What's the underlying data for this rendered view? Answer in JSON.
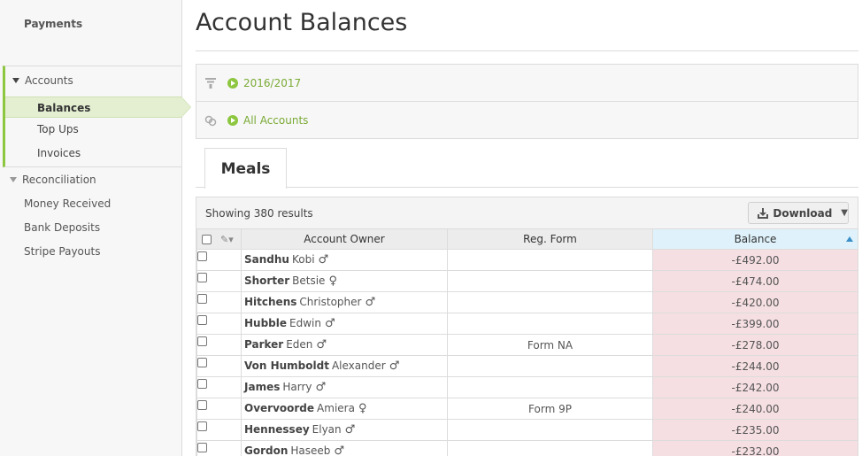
{
  "sidebar": {
    "payments": "Payments",
    "accounts": "Accounts",
    "balances": "Balances",
    "top_ups": "Top Ups",
    "invoices": "Invoices",
    "reconciliation": "Reconciliation",
    "money_received": "Money Received",
    "bank_deposits": "Bank Deposits",
    "stripe_payouts": "Stripe Payouts"
  },
  "page": {
    "title": "Account Balances"
  },
  "filters": {
    "year": "2016/2017",
    "accounts": "All Accounts"
  },
  "tabs": [
    {
      "label": "Meals"
    }
  ],
  "results": {
    "showing": "Showing 380 results",
    "download": "Download"
  },
  "table": {
    "headers": {
      "owner": "Account Owner",
      "reg_form": "Reg. Form",
      "balance": "Balance"
    },
    "rows": [
      {
        "surname": "Sandhu",
        "first": "Kobi",
        "gender": "♂",
        "reg_form": "",
        "balance": "-£492.00"
      },
      {
        "surname": "Shorter",
        "first": "Betsie",
        "gender": "♀",
        "reg_form": "",
        "balance": "-£474.00"
      },
      {
        "surname": "Hitchens",
        "first": "Christopher",
        "gender": "♂",
        "reg_form": "",
        "balance": "-£420.00"
      },
      {
        "surname": "Hubble",
        "first": "Edwin",
        "gender": "♂",
        "reg_form": "",
        "balance": "-£399.00"
      },
      {
        "surname": "Parker",
        "first": "Eden",
        "gender": "♂",
        "reg_form": "Form NA",
        "balance": "-£278.00"
      },
      {
        "surname": "Von Humboldt",
        "first": "Alexander",
        "gender": "♂",
        "reg_form": "",
        "balance": "-£244.00"
      },
      {
        "surname": "James",
        "first": "Harry",
        "gender": "♂",
        "reg_form": "",
        "balance": "-£242.00"
      },
      {
        "surname": "Overvoorde",
        "first": "Amiera",
        "gender": "♀",
        "reg_form": "Form 9P",
        "balance": "-£240.00"
      },
      {
        "surname": "Hennessey",
        "first": "Elyan",
        "gender": "♂",
        "reg_form": "",
        "balance": "-£235.00"
      },
      {
        "surname": "Gordon",
        "first": "Haseeb",
        "gender": "♂",
        "reg_form": "",
        "balance": "-£232.00"
      }
    ]
  }
}
